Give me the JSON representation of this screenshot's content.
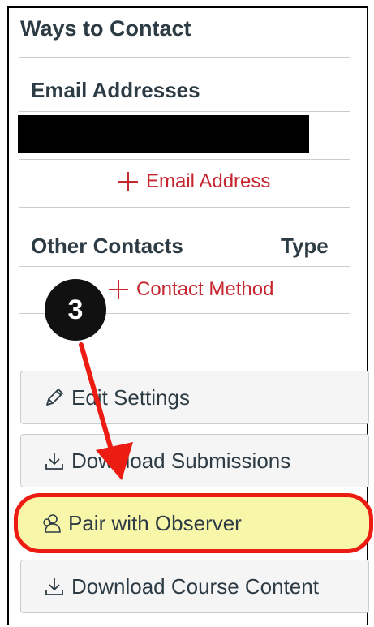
{
  "panel": {
    "title": "Ways to Contact",
    "email_section_title": "Email Addresses",
    "add_email_label": "Email Address",
    "other_contacts_title": "Other Contacts",
    "type_col_label": "Type",
    "add_contact_label": "Contact Method"
  },
  "buttons": {
    "edit_settings": "Edit Settings",
    "download_submissions": "Download Submissions",
    "pair_with_observer": "Pair with Observer",
    "download_course_content": "Download Course Content"
  },
  "annotation": {
    "step_number": "3",
    "highlight_color": "#ec1c13"
  },
  "icons": {
    "edit": "pencil-icon",
    "download": "download-icon",
    "observer": "user-pair-icon",
    "add": "plus-icon"
  },
  "colors": {
    "link": "#c5262f",
    "text": "#2d3b45",
    "button_bg": "#f5f5f5",
    "highlight_fill": "#f8f6a8"
  }
}
